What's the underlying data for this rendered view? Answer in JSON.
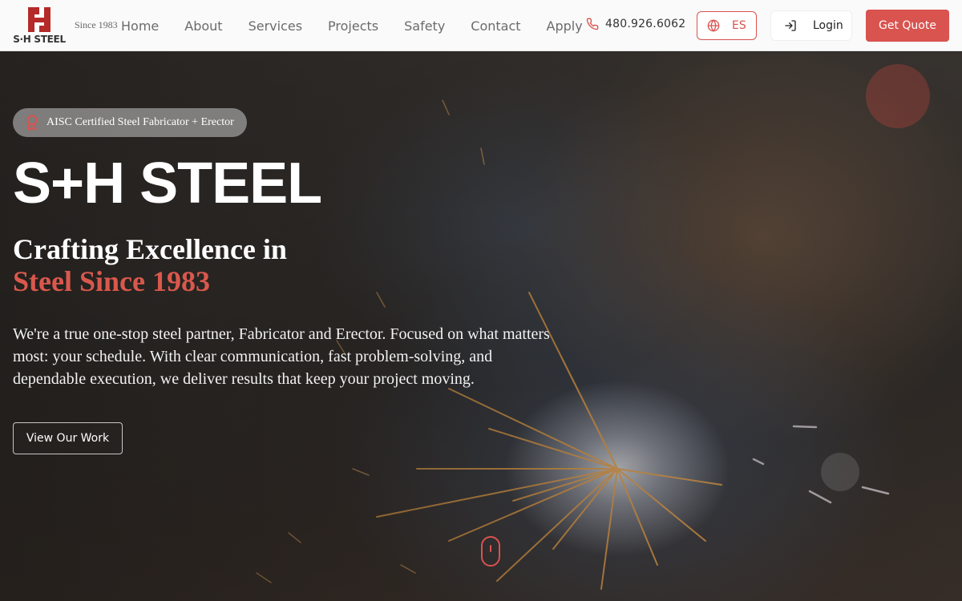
{
  "brand": {
    "logo_letters": "SH",
    "logo_word": "S·H STEEL",
    "since": "Since 1983",
    "accent_color": "#d9534f"
  },
  "nav": {
    "links": [
      "Home",
      "About",
      "Services",
      "Projects",
      "Safety",
      "Contact",
      "Apply"
    ],
    "phone": "480.926.6062",
    "phone_icon": "phone-icon",
    "language_label": "ES",
    "language_icon": "globe-icon",
    "login_label": "Login",
    "login_icon": "log-in-icon",
    "quote_label": "Get Quote"
  },
  "hero": {
    "badge_icon": "award-icon",
    "badge_text": "AISC Certified Steel Fabricator + Erector",
    "title": "S+H STEEL",
    "subtitle_line1": "Crafting Excellence in",
    "subtitle_line2": "Steel Since 1983",
    "description": "We're a true one-stop steel partner, Fabricator and Erector. Focused on what matters most: your schedule. With clear communication, fast problem-solving, and dependable execution, we deliver results that keep your project moving.",
    "cta_label": "View Our Work",
    "scroll_icon": "mouse-scroll-icon"
  }
}
